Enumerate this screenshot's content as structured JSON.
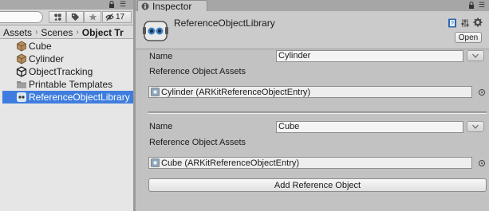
{
  "project": {
    "hidden_count": "17",
    "breadcrumb": [
      "Assets",
      "Scenes",
      "Object Tr"
    ],
    "assets": [
      {
        "label": "Cube",
        "icon": "prefab-icon"
      },
      {
        "label": "Cylinder",
        "icon": "prefab-icon"
      },
      {
        "label": "ObjectTracking",
        "icon": "unity-scene-icon"
      },
      {
        "label": "Printable Templates",
        "icon": "folder-icon"
      },
      {
        "label": "ReferenceObjectLibrary",
        "icon": "scriptable-object-icon",
        "selected": true
      }
    ]
  },
  "inspector": {
    "tab_label": "Inspector",
    "object_title": "ReferenceObjectLibrary",
    "open_label": "Open",
    "entries": [
      {
        "name_label": "Name",
        "name_value": "Cylinder",
        "assets_label": "Reference Object Assets",
        "asset_ref": "Cylinder (ARKitReferenceObjectEntry)"
      },
      {
        "name_label": "Name",
        "name_value": "Cube",
        "assets_label": "Reference Object Assets",
        "asset_ref": "Cube (ARKitReferenceObjectEntry)"
      }
    ],
    "add_button_label": "Add Reference Object"
  },
  "colors": {
    "selection": "#3e7ddf",
    "panel_bg": "#c2c2c2",
    "project_bg": "#e6e6e6"
  }
}
